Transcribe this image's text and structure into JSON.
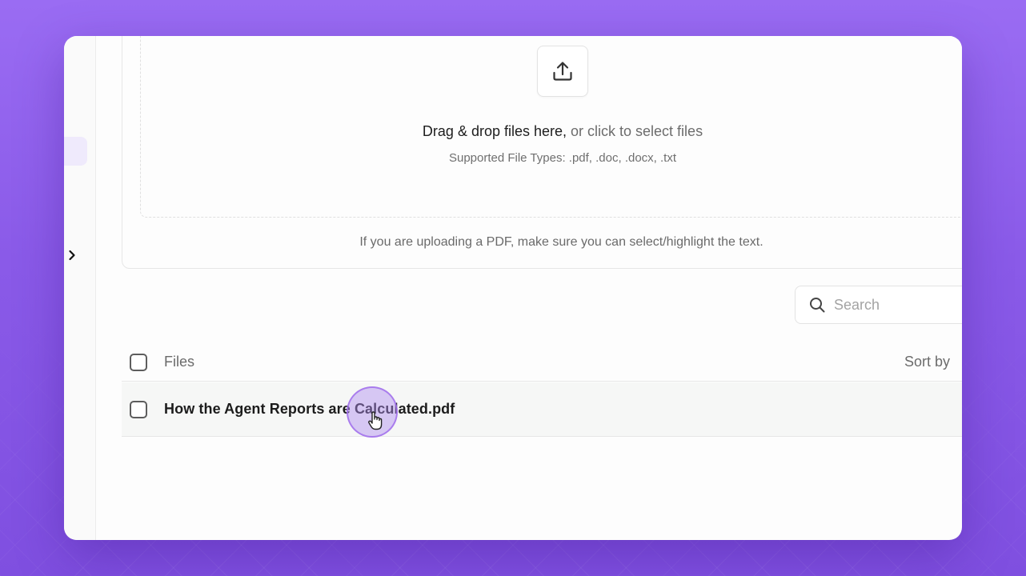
{
  "dropzone": {
    "primary_text": "Drag & drop files here,",
    "secondary_text": " or click to select files",
    "supported_types": "Supported File Types: .pdf, .doc, .docx, .txt",
    "upload_icon": "upload-icon"
  },
  "pdf_note": "If you are uploading a PDF, make sure you can select/highlight the text.",
  "search": {
    "placeholder": "Search",
    "value": "",
    "icon": "search-icon"
  },
  "table": {
    "columns": {
      "files": "Files",
      "sort_by": "Sort by"
    },
    "rows": [
      {
        "name": "How the Agent Reports are Calculated.pdf"
      }
    ]
  },
  "sidebar": {
    "toggle_icon": "chevron-right-icon"
  },
  "colors": {
    "accent": "#8a5ae8",
    "highlight": "#efeafc"
  }
}
